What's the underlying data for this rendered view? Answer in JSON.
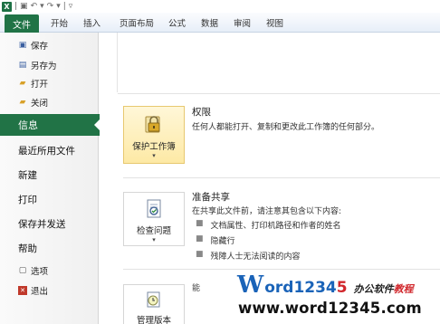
{
  "qat": {
    "icons": [
      "excel-logo",
      "save-icon",
      "undo-icon",
      "redo-icon",
      "customize-icon"
    ]
  },
  "ribbon": {
    "file": "文件",
    "tabs": [
      "开始",
      "插入",
      "页面布局",
      "公式",
      "数据",
      "审阅",
      "视图"
    ]
  },
  "nav": {
    "save": "保存",
    "save_as": "另存为",
    "open": "打开",
    "close": "关闭",
    "info": "信息",
    "recent": "最近所用文件",
    "new": "新建",
    "print": "打印",
    "save_send": "保存并发送",
    "help": "帮助",
    "options": "选项",
    "exit": "退出"
  },
  "sections": {
    "permissions": {
      "button": "保护工作簿",
      "title": "权限",
      "desc": "任何人都能打开、复制和更改此工作簿的任何部分。"
    },
    "prepare": {
      "button": "检查问题",
      "title": "准备共享",
      "desc": "在共享此文件前，请注意其包含以下内容:",
      "items": [
        "文档属性、打印机路径和作者的姓名",
        "隐藏行",
        "残障人士无法阅读的内容"
      ]
    },
    "versions": {
      "button": "管理版本",
      "title": "能"
    }
  },
  "watermark": {
    "W": "W",
    "ord": "ord",
    "num_blue": "1234",
    "num_red": "5",
    "cn_a": "办公软件",
    "cn_b": "教程",
    "url": "www.word12345.com"
  },
  "colors": {
    "file_green": "#217346",
    "highlight": "#fde9a5"
  }
}
